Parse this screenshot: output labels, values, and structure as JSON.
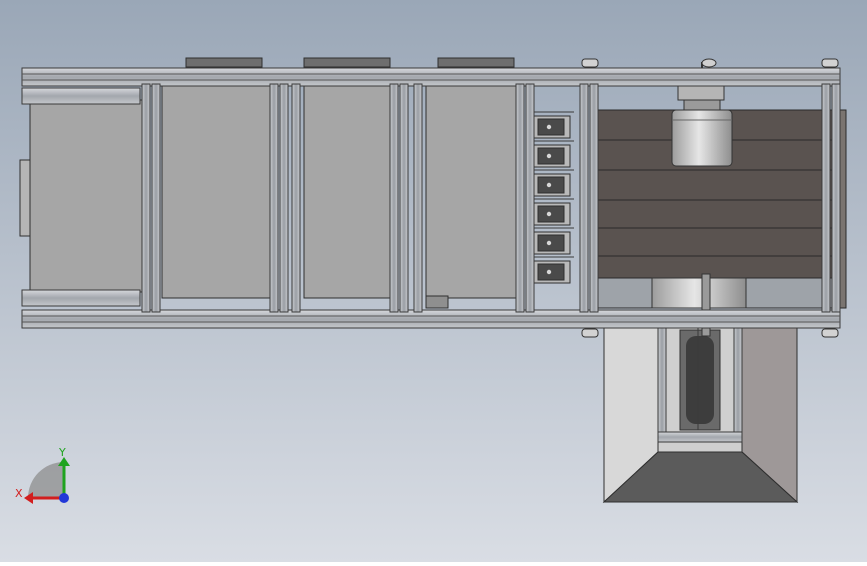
{
  "viewport": {
    "background_top": "#9aa7b7",
    "background_bottom": "#d9dde4"
  },
  "triad": {
    "x_label": "X",
    "y_label": "Y",
    "x_color": "#d21e1e",
    "y_color": "#1fa31f",
    "z_color": "#2238d8"
  },
  "model": {
    "frame_color": "#a4a8ae",
    "frame_edge": "#3a3a3a",
    "panel_color": "#a6a6a6",
    "belt_color": "#5a5350",
    "chute_light": "#cfcfcf",
    "chute_dark": "#5b5b5b",
    "motor_color": "#c4c4c4"
  }
}
